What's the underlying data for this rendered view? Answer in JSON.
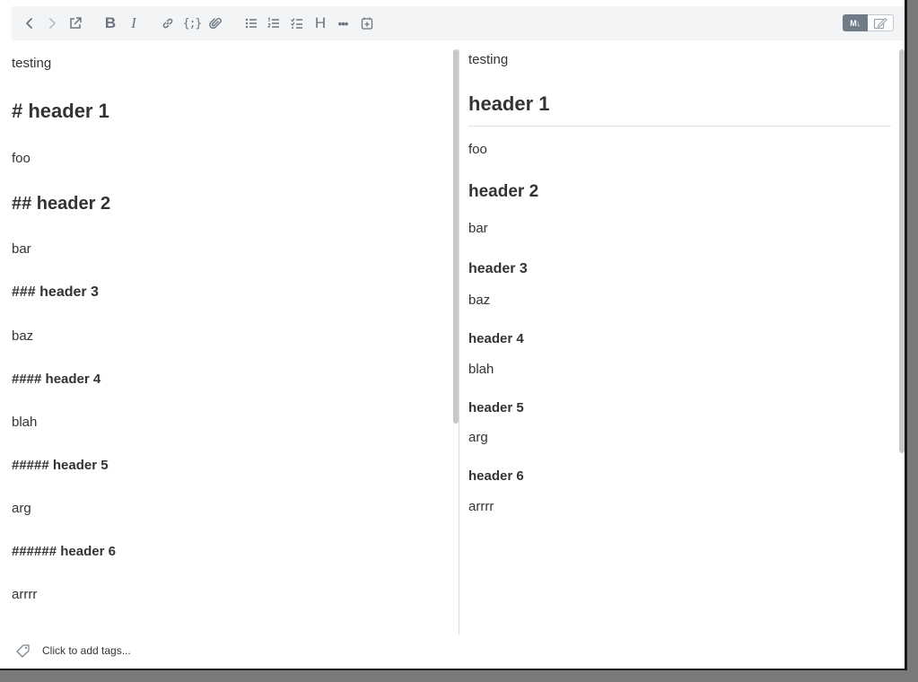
{
  "toolbar": {
    "buttons": [
      {
        "name": "back-button",
        "icon": "chevron-left-icon",
        "disabled": false
      },
      {
        "name": "forward-button",
        "icon": "chevron-right-icon",
        "disabled": true
      },
      {
        "name": "open-external-button",
        "icon": "open-external-icon",
        "disabled": false
      },
      {
        "name": "bold-button",
        "icon": "bold-icon",
        "label": "B"
      },
      {
        "name": "italic-button",
        "icon": "italic-icon",
        "label": "I"
      },
      {
        "name": "link-button",
        "icon": "link-icon"
      },
      {
        "name": "code-button",
        "icon": "code-braces-icon",
        "label": "{;}"
      },
      {
        "name": "attachment-button",
        "icon": "paperclip-icon"
      },
      {
        "name": "bullet-list-button",
        "icon": "bullet-list-icon"
      },
      {
        "name": "numbered-list-button",
        "icon": "numbered-list-icon"
      },
      {
        "name": "checklist-button",
        "icon": "checklist-icon"
      },
      {
        "name": "heading-button",
        "icon": "heading-icon",
        "label": "H"
      },
      {
        "name": "more-button",
        "icon": "more-dots-icon",
        "label": "•••"
      },
      {
        "name": "insert-date-button",
        "icon": "calendar-plus-icon"
      }
    ],
    "mode_toggle": {
      "markdown_label": "M↓",
      "edit_icon": "edit-icon"
    }
  },
  "editor": {
    "lines": [
      {
        "kind": "p",
        "text": "testing"
      },
      {
        "kind": "h1",
        "text": "# header 1"
      },
      {
        "kind": "p",
        "text": "foo"
      },
      {
        "kind": "h2",
        "text": "## header 2"
      },
      {
        "kind": "p",
        "text": "bar"
      },
      {
        "kind": "h3",
        "text": "### header 3"
      },
      {
        "kind": "p",
        "text": "baz"
      },
      {
        "kind": "h4",
        "text": "#### header 4"
      },
      {
        "kind": "p",
        "text": "blah"
      },
      {
        "kind": "h5",
        "text": "##### header 5"
      },
      {
        "kind": "p",
        "text": "arg"
      },
      {
        "kind": "h6",
        "text": "###### header 6"
      },
      {
        "kind": "p",
        "text": "arrrr"
      }
    ]
  },
  "preview": {
    "lines": [
      {
        "kind": "p",
        "text": "testing"
      },
      {
        "kind": "h1",
        "text": "header 1"
      },
      {
        "kind": "p",
        "text": "foo"
      },
      {
        "kind": "h2",
        "text": "header 2"
      },
      {
        "kind": "p",
        "text": "bar"
      },
      {
        "kind": "h3",
        "text": "header 3"
      },
      {
        "kind": "p",
        "text": "baz"
      },
      {
        "kind": "h4",
        "text": "header 4"
      },
      {
        "kind": "p",
        "text": "blah"
      },
      {
        "kind": "h5",
        "text": "header 5"
      },
      {
        "kind": "p",
        "text": "arg"
      },
      {
        "kind": "h6",
        "text": "header 6"
      },
      {
        "kind": "p",
        "text": "arrrr"
      }
    ]
  },
  "footer": {
    "tag_icon": "tag-icon",
    "tags_placeholder": "Click to add tags..."
  }
}
